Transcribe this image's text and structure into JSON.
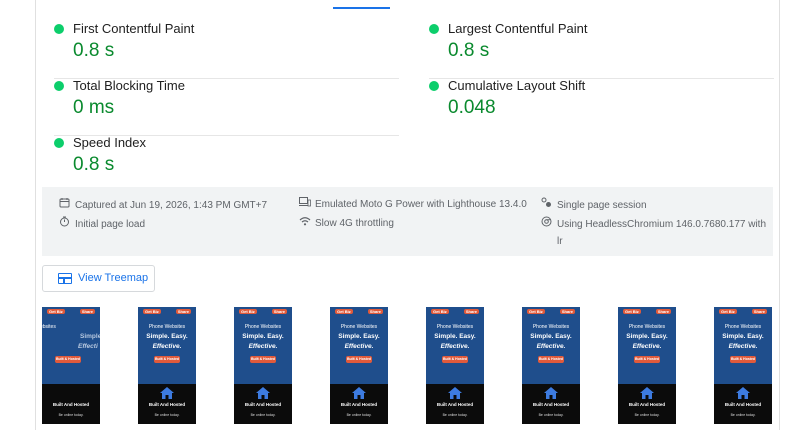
{
  "metrics": [
    {
      "label": "First Contentful Paint",
      "value": "0.8 s",
      "status_color": "#0cce6b"
    },
    {
      "label": "Largest Contentful Paint",
      "value": "0.8 s",
      "status_color": "#0cce6b"
    },
    {
      "label": "Total Blocking Time",
      "value": "0 ms",
      "status_color": "#0cce6b"
    },
    {
      "label": "Cumulative Layout Shift",
      "value": "0.048",
      "status_color": "#0cce6b"
    },
    {
      "label": "Speed Index",
      "value": "0.8 s",
      "status_color": "#0cce6b"
    }
  ],
  "run_info": {
    "captured": {
      "icon": "calendar-icon",
      "text": "Captured at Jun 19, 2026, 1:43 PM GMT+7"
    },
    "device": {
      "icon": "devices-icon",
      "text": "Emulated Moto G Power with Lighthouse 13.4.0"
    },
    "session": {
      "icon": "session-icon",
      "text": "Single page session"
    },
    "load": {
      "icon": "timer-icon",
      "text": "Initial page load"
    },
    "throttling": {
      "icon": "wifi-icon",
      "text": "Slow 4G throttling"
    },
    "browser": {
      "icon": "chrome-icon",
      "text": "Using HeadlessChromium 146.0.7680.177 with",
      "text_wrap": "lr"
    }
  },
  "treemap_button": {
    "label": "View Treemap",
    "icon": "treemap-icon"
  },
  "filmstrip": {
    "frame_count": 8,
    "thumb": {
      "pill_left": "Get Biz",
      "pill_right": "Share",
      "headline_small": "Phone Websites",
      "headline_1": "Simple. Easy.",
      "headline_2": "Effective.",
      "cta": "Built & Hosted",
      "footer_title": "Built And Hosted",
      "footer_text": "Be online today.",
      "first_partial_1": "Simple",
      "first_partial_2": "Effecti",
      "first_partial_small": "ebsites"
    }
  },
  "colors": {
    "good": "#0cce6b",
    "value_text": "#0a8a2e",
    "accent": "#1a73e8",
    "thumb_bg": "#1f4e8c",
    "thumb_button": "#e05a3b"
  }
}
